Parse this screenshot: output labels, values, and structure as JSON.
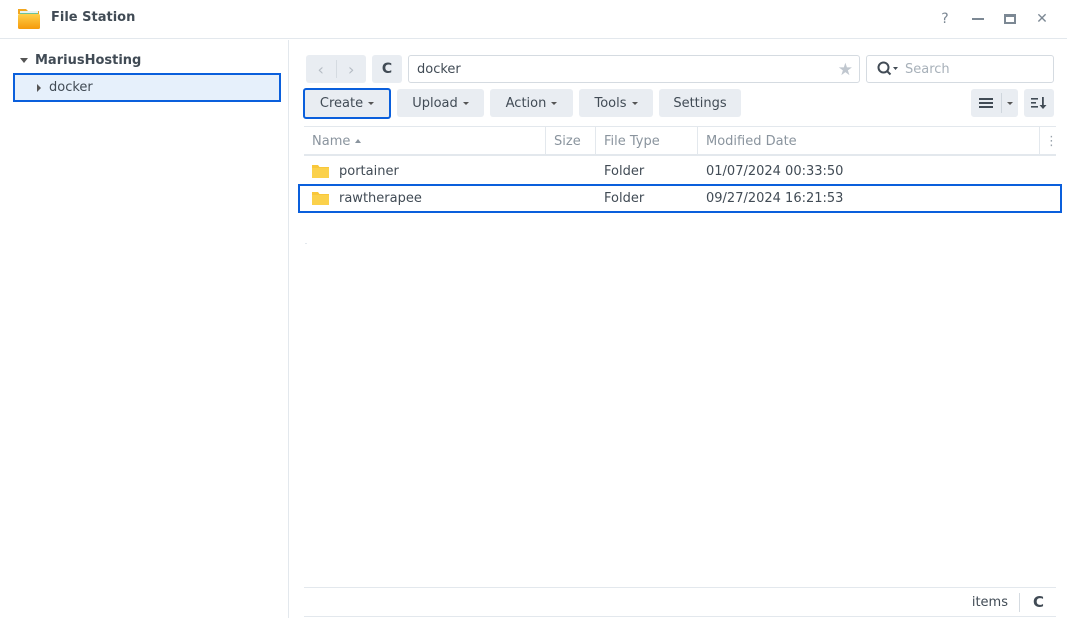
{
  "window": {
    "title": "File Station",
    "controls": {
      "help": "?",
      "minimize": "—",
      "maximize": "▭",
      "close": "✕"
    }
  },
  "sidebar": {
    "root_label": "MariusHosting",
    "items": [
      {
        "label": "docker",
        "selected": true
      }
    ]
  },
  "toolbar": {
    "back_icon": "‹",
    "forward_icon": "›",
    "refresh_icon": "C",
    "path_value": "docker",
    "favorite_icon": "★",
    "search_placeholder": "Search",
    "buttons": {
      "create": "Create",
      "upload": "Upload",
      "action": "Action",
      "tools": "Tools",
      "settings": "Settings"
    }
  },
  "table": {
    "columns": {
      "name": "Name",
      "size": "Size",
      "file_type": "File Type",
      "modified_date": "Modified Date"
    },
    "sort": {
      "column": "Name",
      "direction": "ascending"
    },
    "rows": [
      {
        "name": "portainer",
        "size": "",
        "file_type": "Folder",
        "modified_date": "01/07/2024 00:33:50",
        "selected": false
      },
      {
        "name": "rawtherapee",
        "size": "",
        "file_type": "Folder",
        "modified_date": "09/27/2024 16:21:53",
        "selected": true
      }
    ]
  },
  "footer": {
    "items_label": "items",
    "refresh_icon": "C"
  },
  "colors": {
    "accent": "#0a5fdc",
    "selected_bg": "#e6f0fb",
    "button_bg": "#e9edf2",
    "folder": "#f9c73a"
  }
}
